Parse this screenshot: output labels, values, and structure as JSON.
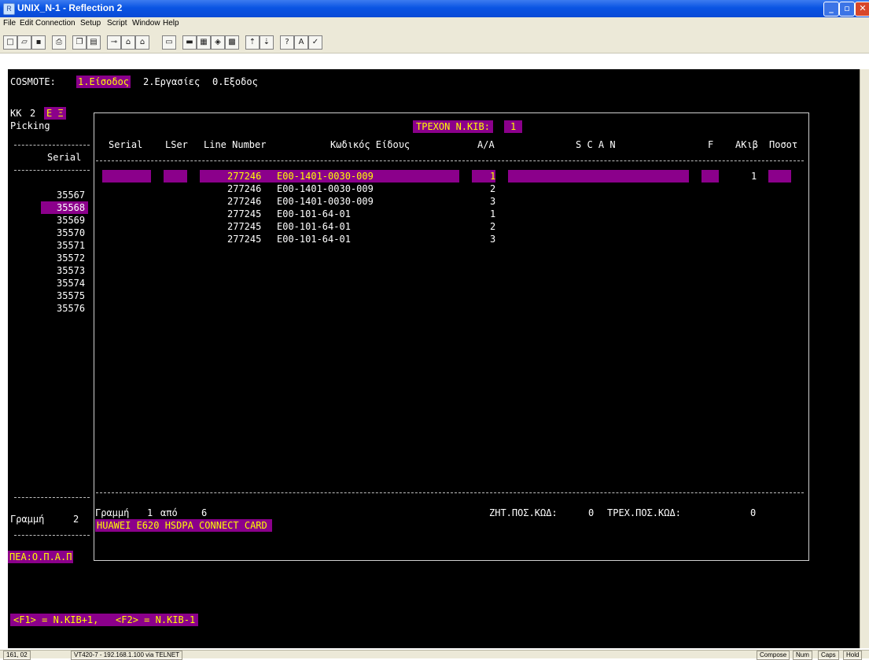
{
  "window": {
    "title": "UNIX_N-1 - Reflection 2",
    "menu": [
      "File",
      "Edit",
      "Connection",
      "Setup",
      "Script",
      "Window",
      "Help"
    ],
    "toolbar_icons": [
      "new-icon",
      "open-icon",
      "save-icon",
      "print-icon",
      "copy-icon",
      "paste-icon",
      "connect-icon",
      "disconnect-icon",
      "transfer-icon",
      "script-icon",
      "display-setup-icon",
      "terminal-setup-icon",
      "keyboard-setup-icon",
      "color-setup-icon",
      "upload-icon",
      "download-icon",
      "help-icon",
      "spell-icon",
      "abc-icon"
    ]
  },
  "terminal": {
    "company": "COSMOTE:",
    "menu": {
      "item1": "1.Είσοδος",
      "item2": "2.Εργασίες",
      "item0": "0.Εξοδος"
    },
    "kk_label": "KK",
    "kk_value": "2",
    "kk_tag": "E Ξ",
    "picking_label": "Picking",
    "serial_label": "Serial",
    "serials": [
      "35567",
      "35568",
      "35569",
      "35570",
      "35571",
      "35572",
      "35573",
      "35574",
      "35575",
      "35576"
    ],
    "selected_serial": "35568",
    "current_kib_label": "ΤΡΕΧΟΝ Ν.ΚΙΒ:",
    "current_kib_value": "1",
    "columns": {
      "serial": "Serial",
      "lser": "LSer",
      "line_number": "Line Number",
      "code": "Κωδικός Είδους",
      "aa": "Α/Α",
      "scan": "S C A N",
      "f": "F",
      "akib": "ΑΚιβ",
      "poso": "Ποσοτ"
    },
    "rows": [
      {
        "line_number": "277246",
        "code": "E00-1401-0030-009",
        "aa": "1",
        "akib": "1"
      },
      {
        "line_number": "277246",
        "code": "E00-1401-0030-009",
        "aa": "2",
        "akib": ""
      },
      {
        "line_number": "277246",
        "code": "E00-1401-0030-009",
        "aa": "3",
        "akib": ""
      },
      {
        "line_number": "277245",
        "code": "E00-101-64-01",
        "aa": "1",
        "akib": ""
      },
      {
        "line_number": "277245",
        "code": "E00-101-64-01",
        "aa": "2",
        "akib": ""
      },
      {
        "line_number": "277245",
        "code": "E00-101-64-01",
        "aa": "3",
        "akib": ""
      }
    ],
    "footer": {
      "line_label": "Γραμμή",
      "line_current": "1",
      "of_label": "από",
      "line_total": "6",
      "req_qty_label": "ΖΗΤ.ΠΟΣ.ΚΩΔ:",
      "req_qty_value": "0",
      "cur_qty_label": "ΤΡΕΧ.ΠΟΣ.ΚΩΔ:",
      "cur_qty_value": "0",
      "item_description": "HUAWEI E620 HSDPA CONNECT CARD",
      "left_line_label": "Γραμμή",
      "left_line_value": "2",
      "customer": "ΠΕΑ:Ο.Π.Α.Π"
    },
    "hint": "<F1> = N.KIB+1,   <F2> = N.KIB-1"
  },
  "statusbar": {
    "cursor": "161, 02",
    "connection": "VT420-7 - 192.168.1.100 via TELNET",
    "compose": "Compose",
    "num": "Num",
    "caps": "Caps",
    "hold": "Hold"
  }
}
